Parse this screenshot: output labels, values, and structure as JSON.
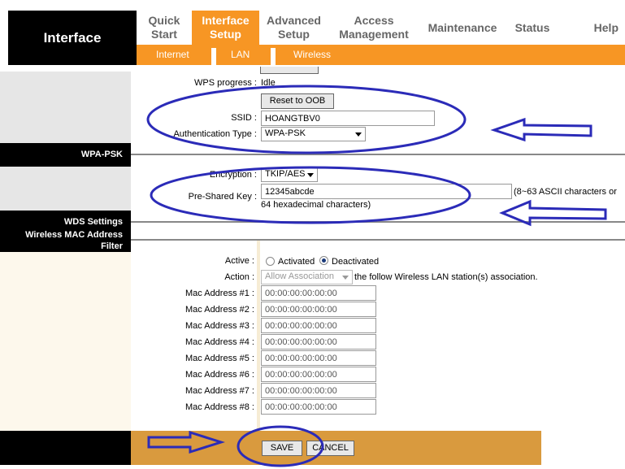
{
  "brand": {
    "title": "Interface"
  },
  "nav": {
    "tabs": [
      {
        "label": "Quick\nStart"
      },
      {
        "label": "Interface\nSetup"
      },
      {
        "label": "Advanced\nSetup"
      },
      {
        "label": "Access\nManagement"
      },
      {
        "label": "Maintenance"
      },
      {
        "label": "Status"
      },
      {
        "label": "Help"
      }
    ],
    "subtabs": [
      "Internet",
      "LAN",
      "Wireless"
    ]
  },
  "wps": {
    "progress_label": "WPS progress :",
    "progress_value": "Idle"
  },
  "reset_button": "Reset to OOB",
  "ssid": {
    "label": "SSID :",
    "value": "HOANGTBV0"
  },
  "auth": {
    "label": "Authentication Type :",
    "value": "WPA-PSK"
  },
  "sections": {
    "wpa_psk": "WPA-PSK",
    "wds": "WDS Settings",
    "mac_filter_line1": "Wireless MAC Address",
    "mac_filter_line2": "Filter"
  },
  "encryption": {
    "label": "Encryption :",
    "value": "TKIP/AES"
  },
  "psk": {
    "label": "Pre-Shared Key :",
    "value": "12345abcde",
    "hint_line1": "(8~63 ASCII characters or",
    "hint_line2": "64 hexadecimal characters)"
  },
  "mac_filter": {
    "active_label": "Active :",
    "activated": "Activated",
    "deactivated": "Deactivated",
    "selected": "Deactivated",
    "action_label": "Action :",
    "action_value": "Allow Association",
    "action_suffix": "the follow Wireless LAN station(s) association.",
    "addresses": [
      {
        "label": "Mac Address #1 :",
        "value": "00:00:00:00:00:00"
      },
      {
        "label": "Mac Address #2 :",
        "value": "00:00:00:00:00:00"
      },
      {
        "label": "Mac Address #3 :",
        "value": "00:00:00:00:00:00"
      },
      {
        "label": "Mac Address #4 :",
        "value": "00:00:00:00:00:00"
      },
      {
        "label": "Mac Address #5 :",
        "value": "00:00:00:00:00:00"
      },
      {
        "label": "Mac Address #6 :",
        "value": "00:00:00:00:00:00"
      },
      {
        "label": "Mac Address #7 :",
        "value": "00:00:00:00:00:00"
      },
      {
        "label": "Mac Address #8 :",
        "value": "00:00:00:00:00:00"
      }
    ]
  },
  "footer": {
    "save": "SAVE",
    "cancel": "CANCEL"
  },
  "colors": {
    "orange": "#f79624",
    "footer": "#d99a3e",
    "annotation": "#2b2bb8"
  }
}
